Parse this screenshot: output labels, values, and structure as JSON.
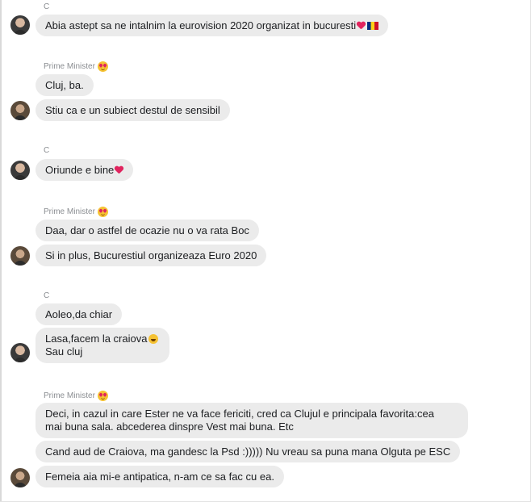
{
  "conversation": {
    "groups": [
      {
        "sender": "C",
        "messages": [
          "Abia astept sa ne intalnim la eurovision 2020 organizat in bucuresti"
        ]
      },
      {
        "sender": "Prime Minister",
        "messages": [
          "Cluj, ba.",
          "Stiu ca e un subiect destul de sensibil"
        ]
      },
      {
        "sender": "C",
        "messages": [
          "Oriunde e bine"
        ]
      },
      {
        "sender": "Prime Minister",
        "messages": [
          "Daa, dar o astfel de ocazie nu o va rata Boc",
          "Si in plus, Bucurestiul organizeaza Euro 2020"
        ]
      },
      {
        "sender": "C",
        "messages": [
          "Aoleo,da chiar",
          "Lasa,facem la craiova",
          "Sau cluj"
        ]
      },
      {
        "sender": "Prime Minister",
        "messages": [
          "Deci, in cazul in care Ester ne va face fericiti, cred ca Clujul e principala favorita:cea",
          "mai buna sala. abcederea dinspre Vest mai buna. Etc",
          "Cand aud de Craiova, ma gandesc la Psd :))))) Nu vreau sa puna mana Olguta pe ESC",
          "Femeia aia mi-e antipatica, n-am ce sa fac cu ea."
        ]
      }
    ]
  }
}
